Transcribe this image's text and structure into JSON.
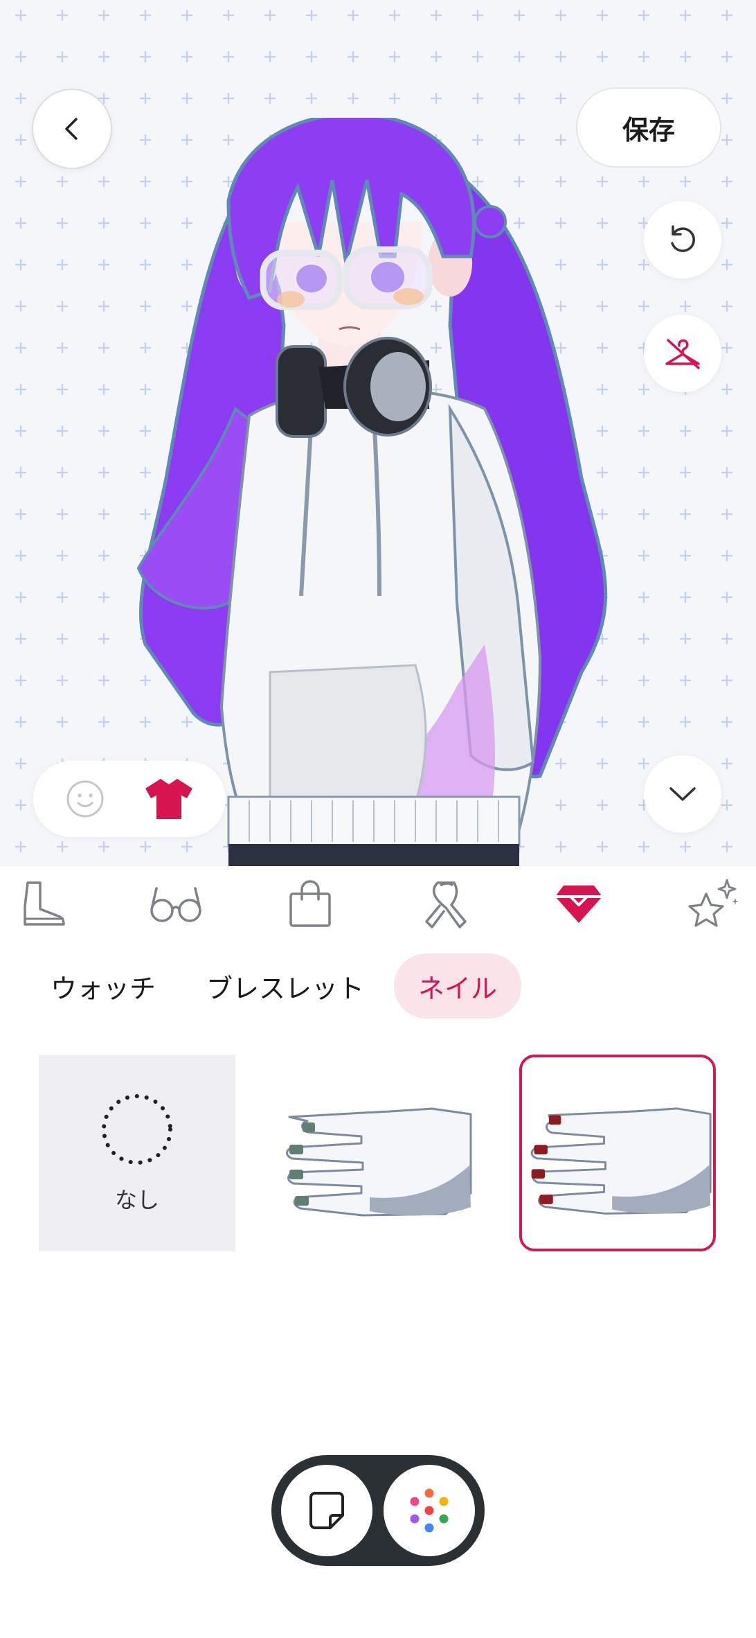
{
  "header": {
    "back_icon": "chevron-left-icon",
    "save_label": "保存"
  },
  "preview": {
    "reset_icon": "undo-icon",
    "hide_icon": "hide-clothes-icon",
    "collapse_icon": "chevron-down-icon",
    "mode_toggle": {
      "options": [
        "face-icon",
        "shirt-icon"
      ],
      "selected": "shirt-icon"
    }
  },
  "categories": [
    {
      "icon": "boot-icon",
      "selected": false
    },
    {
      "icon": "glasses-icon",
      "selected": false
    },
    {
      "icon": "bag-icon",
      "selected": false
    },
    {
      "icon": "ribbon-icon",
      "selected": false
    },
    {
      "icon": "gem-icon",
      "selected": true
    },
    {
      "icon": "sparkle-star-icon",
      "selected": false
    }
  ],
  "subtabs": [
    {
      "label": "ウォッチ",
      "selected": false
    },
    {
      "label": "ブレスレット",
      "selected": false
    },
    {
      "label": "ネイル",
      "selected": true
    }
  ],
  "items": [
    {
      "label": "なし",
      "selected": false
    },
    {
      "nail_color": "#5f7f72",
      "selected": false
    },
    {
      "nail_color": "#8e1a22",
      "selected": true
    }
  ],
  "dock": {
    "note_icon": "sticky-note-icon",
    "apps_icon": "apps-dots-icon"
  },
  "colors": {
    "accent": "#d6144f",
    "accent_bg": "#fbe3ea",
    "hair": "#8a3bf0",
    "dock": "#2a3033"
  }
}
